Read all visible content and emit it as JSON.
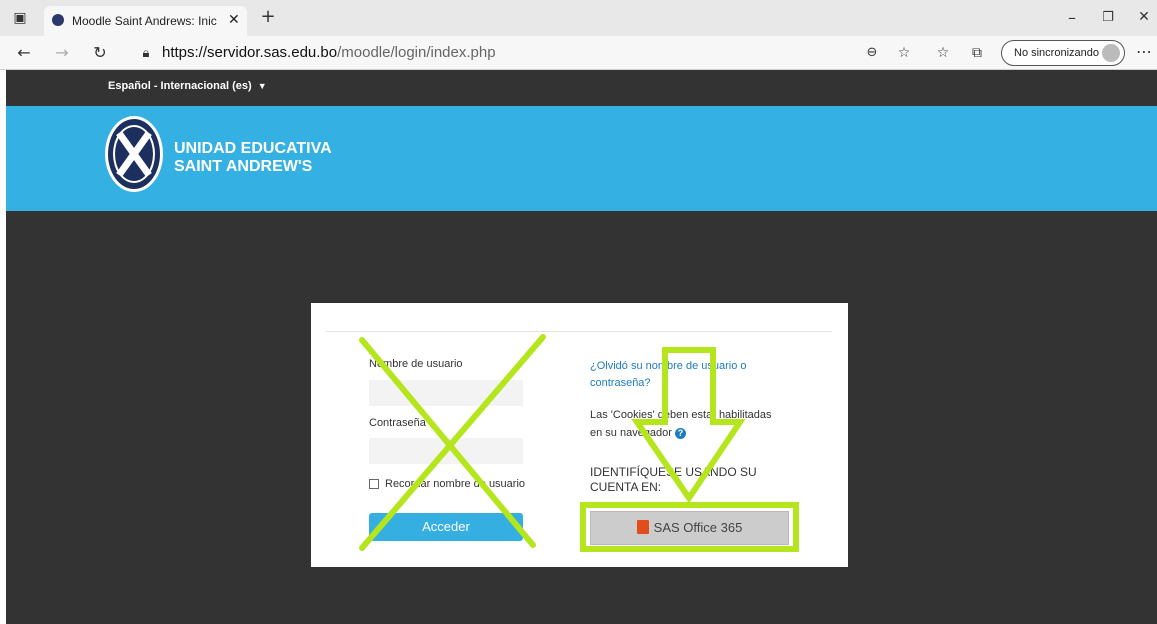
{
  "browser": {
    "tab_title": "Moodle Saint Andrews: Iniciar se",
    "url_domain": "https://servidor.sas.edu.bo",
    "url_path": "/moodle/login/index.php",
    "sync_label": "No sincronizando"
  },
  "site": {
    "language": "Español - Internacional (es)",
    "logo_line1": "UNIDAD EDUCATIVA",
    "logo_line2": "SAINT ANDREW'S"
  },
  "login": {
    "username_label": "Nombre de usuario",
    "password_label": "Contraseña",
    "remember_label": "Recordar nombre de usuario",
    "submit_label": "Acceder",
    "forgot_link": "¿Olvidó su nombre de usuario o contraseña?",
    "cookies_note": "Las 'Cookies' deben estar habilitadas en su navegador",
    "identify_heading": "IDENTIFÍQUESE USANDO SU CUENTA EN:",
    "office_button": "SAS Office 365"
  },
  "colors": {
    "banner": "#35b0e2",
    "dark_bg": "#333333",
    "annotation": "#b5e61d"
  },
  "icons": [
    "browser-menu-icon",
    "tab-favicon",
    "back-icon",
    "forward-icon",
    "refresh-icon",
    "lock-icon",
    "zoom-icon",
    "add-favorite-icon",
    "favorites-icon",
    "collections-icon",
    "profile-avatar-icon",
    "more-icon",
    "minimize-icon",
    "restore-icon",
    "close-icon",
    "help-icon",
    "office-icon"
  ]
}
